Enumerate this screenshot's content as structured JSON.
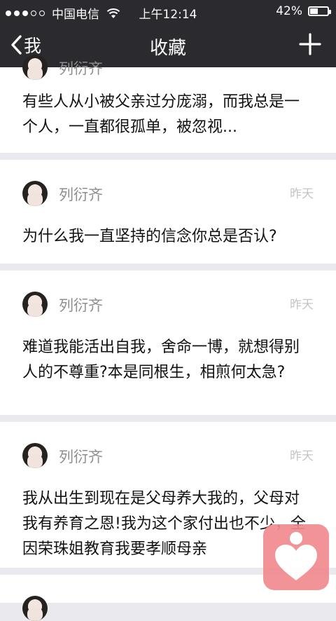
{
  "status": {
    "carrier": "中国电信",
    "time": "上午12:14",
    "battery_text": "42%",
    "battery_level": 0.42
  },
  "nav": {
    "back_label": "我",
    "title": "收藏"
  },
  "posts": [
    {
      "author": "列衍齐",
      "time": "",
      "text": "有些人从小被父亲过分庞溺，而我总是一个人，一直都很孤单，被忽视..."
    },
    {
      "author": "列衍齐",
      "time": "昨天",
      "text": "为什么我一直坚持的信念你总是否认?"
    },
    {
      "author": "列衍齐",
      "time": "昨天",
      "text": "难道我能活出自我，舍命一博，就想得别人的不尊重?本是同根生，相煎何太急?"
    },
    {
      "author": "列衍齐",
      "time": "昨天",
      "text": "我从出生到现在是父母养大我的，父母对我有养育之恩!我为这个家付出也不少，全因荣珠姐教育我要孝顺母亲"
    }
  ],
  "colors": {
    "bar": "#2b2b2f",
    "fab": "#f08a8f"
  },
  "icons": {
    "add": "plus-icon",
    "back": "chevron-left-icon",
    "fab": "heart-icon"
  }
}
